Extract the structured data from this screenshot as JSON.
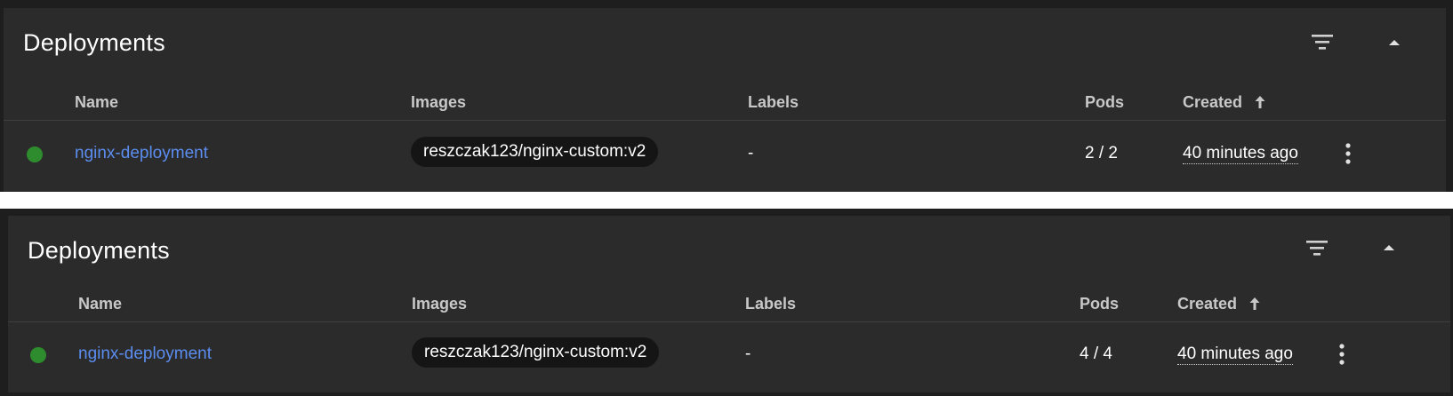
{
  "colors": {
    "background": "#1e1e1e",
    "card": "#2b2b2b",
    "link": "#5b8def",
    "status_running": "#2e8b2e",
    "chip": "#151515"
  },
  "icons": {
    "filter": "filter-icon",
    "collapse": "chevron-up-icon",
    "sort": "arrow-up-icon",
    "menu": "more-vert-icon",
    "status": "status-dot"
  },
  "cards": [
    {
      "title": "Deployments",
      "columns": {
        "name": "Name",
        "images": "Images",
        "labels": "Labels",
        "pods": "Pods",
        "created": "Created"
      },
      "rows": [
        {
          "status": "running",
          "name": "nginx-deployment",
          "image": "reszczak123/nginx-custom:v2",
          "labels": "-",
          "pods": "2 / 2",
          "created": "40 minutes ago"
        }
      ]
    },
    {
      "title": "Deployments",
      "columns": {
        "name": "Name",
        "images": "Images",
        "labels": "Labels",
        "pods": "Pods",
        "created": "Created"
      },
      "rows": [
        {
          "status": "running",
          "name": "nginx-deployment",
          "image": "reszczak123/nginx-custom:v2",
          "labels": "-",
          "pods": "4 / 4",
          "created": "40 minutes ago"
        }
      ]
    }
  ]
}
